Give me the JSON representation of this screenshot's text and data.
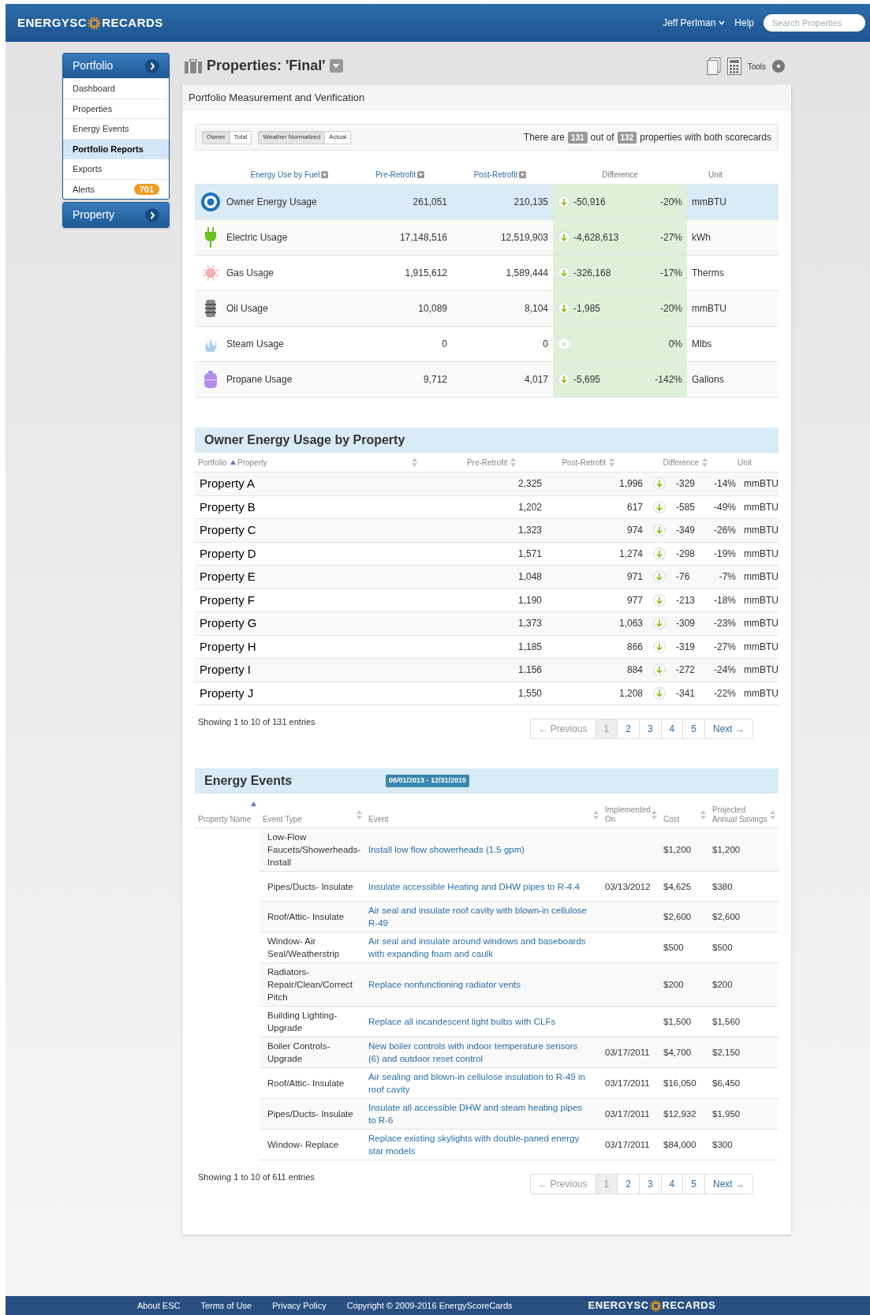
{
  "header": {
    "logo_left": "ENERGYSC",
    "logo_right": "RECARDS",
    "user": "Jeff Perlman",
    "help": "Help",
    "search": {
      "placeholder": "Search Properties"
    }
  },
  "sidebar": [
    {
      "title": "Portfolio",
      "items": [
        {
          "label": "Dashboard",
          "selected": false
        },
        {
          "label": "Properties",
          "selected": false
        },
        {
          "label": "Energy Events",
          "selected": false
        },
        {
          "label": "Portfolio Reports",
          "selected": true
        },
        {
          "label": "Exports",
          "selected": false
        },
        {
          "label": "Alerts",
          "selected": false,
          "badge": "701"
        }
      ]
    },
    {
      "title": "Property"
    }
  ],
  "page": {
    "title": "Properties: 'Final'",
    "tools": "Tools"
  },
  "card": {
    "title": "Portfolio Measurement and Verification"
  },
  "toggle_groups": [
    {
      "options": [
        {
          "label": "Owner",
          "selected": true
        },
        {
          "label": "Total",
          "selected": false
        }
      ]
    },
    {
      "options": [
        {
          "label": "Weather Normalized",
          "selected": true
        },
        {
          "label": "Actual",
          "selected": false
        }
      ]
    }
  ],
  "summary": {
    "before": "There are",
    "count": "131",
    "middle": "out of",
    "total": "132",
    "after": "properties with both scorecards"
  },
  "fuel_table": {
    "columns": [
      {
        "label": "Energy Use by Fuel",
        "sortable": true
      },
      {
        "label": "Pre-Retrofit",
        "sortable": true
      },
      {
        "label": "Post-Retrofit",
        "sortable": true
      },
      {
        "label": "Difference",
        "sortable": false
      },
      {
        "label": "Unit",
        "sortable": false
      }
    ],
    "rows": [
      {
        "kind": "owner",
        "name": "Owner Energy Usage",
        "pre": "261,051",
        "post": "210,135",
        "reduced": true,
        "diff": "-50,916",
        "pct": "-20%",
        "unit": "mmBTU",
        "selected": true
      },
      {
        "kind": "electric",
        "name": "Electric Usage",
        "pre": "17,148,516",
        "post": "12,519,903",
        "reduced": true,
        "diff": "-4,628,613",
        "pct": "-27%",
        "unit": "kWh",
        "selected": false
      },
      {
        "kind": "gas",
        "name": "Gas Usage",
        "pre": "1,915,612",
        "post": "1,589,444",
        "reduced": true,
        "diff": "-326,168",
        "pct": "-17%",
        "unit": "Therms",
        "selected": false
      },
      {
        "kind": "oil",
        "name": "Oil Usage",
        "pre": "10,089",
        "post": "8,104",
        "reduced": true,
        "diff": "-1,985",
        "pct": "-20%",
        "unit": "mmBTU",
        "selected": false
      },
      {
        "kind": "steam",
        "name": "Steam Usage",
        "pre": "0",
        "post": "0",
        "reduced": false,
        "pct": "0%",
        "unit": "Mlbs",
        "selected": false
      },
      {
        "kind": "propane",
        "name": "Propane Usage",
        "pre": "9,712",
        "post": "4,017",
        "reduced": true,
        "diff": "-5,695",
        "pct": "-142%",
        "unit": "Gallons",
        "selected": false
      }
    ]
  },
  "property_table": {
    "title": "Owner Energy Usage by Property",
    "columns": [
      {
        "label": "Portfolio",
        "sorted": true,
        "sortable": true
      },
      {
        "label": "Property",
        "sorted": false,
        "sortable": true
      },
      {
        "label": "Pre-Retrofit",
        "sorted": false,
        "sortable": true
      },
      {
        "label": "Post-Retrofit",
        "sorted": false,
        "sortable": true
      },
      {
        "label": "Difference",
        "sorted": false,
        "sortable": true
      },
      {
        "label": "Unit",
        "sortable": false
      }
    ],
    "rows": [
      {
        "name": "Property A",
        "pre": "2,325",
        "post": "1,996",
        "diff": "-329",
        "pct": "-14%",
        "unit": "mmBTU"
      },
      {
        "name": "Property B",
        "pre": "1,202",
        "post": "617",
        "diff": "-585",
        "pct": "-49%",
        "unit": "mmBTU"
      },
      {
        "name": "Property C",
        "pre": "1,323",
        "post": "974",
        "diff": "-349",
        "pct": "-26%",
        "unit": "mmBTU"
      },
      {
        "name": "Property D",
        "pre": "1,571",
        "post": "1,274",
        "diff": "-298",
        "pct": "-19%",
        "unit": "mmBTU"
      },
      {
        "name": "Property E",
        "pre": "1,048",
        "post": "971",
        "diff": "-76",
        "pct": "-7%",
        "unit": "mmBTU"
      },
      {
        "name": "Property F",
        "pre": "1,190",
        "post": "977",
        "diff": "-213",
        "pct": "-18%",
        "unit": "mmBTU"
      },
      {
        "name": "Property G",
        "pre": "1,373",
        "post": "1,063",
        "diff": "-309",
        "pct": "-23%",
        "unit": "mmBTU"
      },
      {
        "name": "Property H",
        "pre": "1,185",
        "post": "866",
        "diff": "-319",
        "pct": "-27%",
        "unit": "mmBTU"
      },
      {
        "name": "Property I",
        "pre": "1,156",
        "post": "884",
        "diff": "-272",
        "pct": "-24%",
        "unit": "mmBTU"
      },
      {
        "name": "Property J",
        "pre": "1,550",
        "post": "1,208",
        "diff": "-341",
        "pct": "-22%",
        "unit": "mmBTU"
      }
    ],
    "info": "Showing 1 to 10 of 131 entries",
    "pagination": {
      "previous": {
        "label": "← Previous",
        "disabled": true
      },
      "pages": [
        {
          "label": "1",
          "selected": true
        },
        {
          "label": "2",
          "selected": false
        },
        {
          "label": "3",
          "selected": false
        },
        {
          "label": "4",
          "selected": false
        },
        {
          "label": "5",
          "selected": false
        }
      ],
      "next": {
        "label": "Next →",
        "disabled": false
      }
    }
  },
  "events_table": {
    "title": "Energy Events",
    "date_range": "06/01/2013 - 12/31/2015",
    "columns": [
      {
        "label": "Property Name",
        "sorted": true,
        "sortable": true
      },
      {
        "label": "Event Type",
        "sorted": false,
        "sortable": true
      },
      {
        "label": "Event",
        "sorted": false,
        "sortable": true
      },
      {
        "label": "Implemented On",
        "sorted": false,
        "sortable": true
      },
      {
        "label": "Cost",
        "sorted": false,
        "sortable": true
      },
      {
        "label": "Projected Annual Savings",
        "sorted": false,
        "sortable": true
      }
    ],
    "rows": [
      {
        "type": "Low-Flow Faucets/Showerheads- Install",
        "event": "Install low flow showerheads (1.5 gpm)",
        "cost": "$1,200",
        "savings": "$1,200"
      },
      {
        "type": "Pipes/Ducts- Insulate",
        "event": "Insulate accessible Heating and DHW pipes to R-4.4",
        "implemented": "03/13/2012",
        "cost": "$4,625",
        "savings": "$380"
      },
      {
        "type": "Roof/Attic- Insulate",
        "event": "Air seal and insulate roof cavity with blown-in cellulose R-49",
        "cost": "$2,600",
        "savings": "$2,600"
      },
      {
        "type": "Window- Air Seal/Weatherstrip",
        "event": "Air seal and insulate around windows and baseboards with expanding foam and caulk",
        "cost": "$500",
        "savings": "$500"
      },
      {
        "type": "Radiators- Repair/Clean/Correct Pitch",
        "event": "Replace nonfunctioning radiator vents",
        "cost": "$200",
        "savings": "$200"
      },
      {
        "type": "Building Lighting- Upgrade",
        "event": "Replace all incandescent light bulbs with CLFs",
        "cost": "$1,500",
        "savings": "$1,560"
      },
      {
        "type": "Boiler Controls- Upgrade",
        "event": "New boiler controls with indoor temperature sensors (6) and outdoor reset control",
        "implemented": "03/17/2011",
        "cost": "$4,700",
        "savings": "$2,150"
      },
      {
        "type": "Roof/Attic- Insulate",
        "event": "Air sealing and blown-in cellulose insulation to R-49 in roof cavity",
        "implemented": "03/17/2011",
        "cost": "$16,050",
        "savings": "$6,450"
      },
      {
        "type": "Pipes/Ducts- Insulate",
        "event": "Insulate all accessible DHW and steam heating pipes to R-6",
        "implemented": "03/17/2011",
        "cost": "$12,932",
        "savings": "$1,950"
      },
      {
        "type": "Window- Replace",
        "event": "Replace existing skylights with double-paned energy star models",
        "implemented": "03/17/2011",
        "cost": "$84,000",
        "savings": "$300"
      }
    ],
    "info": "Showing 1 to 10 of 611 entries",
    "pagination": {
      "previous": {
        "label": "← Previous",
        "disabled": true
      },
      "pages": [
        {
          "label": "1",
          "selected": true
        },
        {
          "label": "2",
          "selected": false
        },
        {
          "label": "3",
          "selected": false
        },
        {
          "label": "4",
          "selected": false
        },
        {
          "label": "5",
          "selected": false
        }
      ],
      "next": {
        "label": "Next →",
        "disabled": false
      }
    }
  },
  "footer": {
    "links": [
      "About ESC",
      "Terms of Use",
      "Privacy Policy"
    ],
    "copyright": "Copyright © 2009-2016 EnergyScoreCards",
    "logo_left": "ENERGYSC",
    "logo_right": "RECARDS"
  }
}
